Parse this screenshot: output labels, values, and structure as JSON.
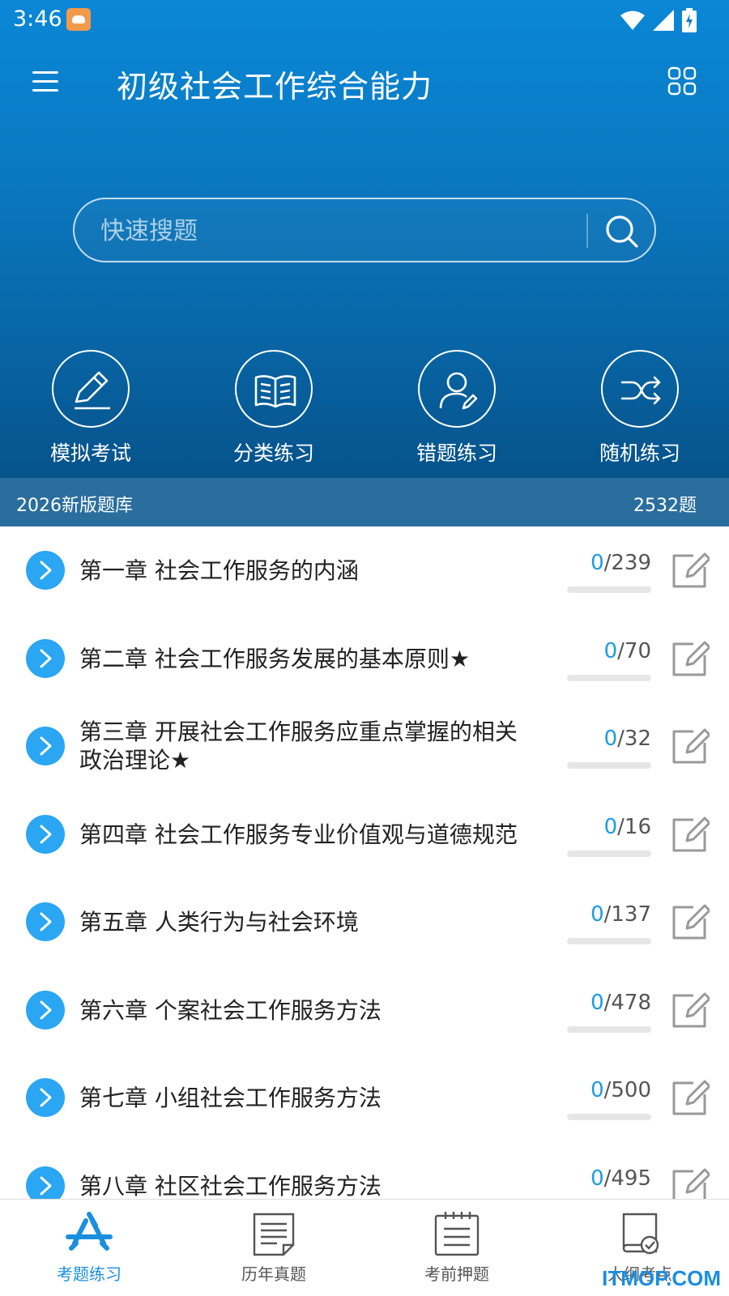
{
  "status": {
    "time": "3:46"
  },
  "header": {
    "title": "初级社会工作综合能力"
  },
  "search": {
    "placeholder": "快速搜题"
  },
  "quick_actions": [
    {
      "label": "模拟考试",
      "icon": "pencil-icon"
    },
    {
      "label": "分类练习",
      "icon": "book-icon"
    },
    {
      "label": "错题练习",
      "icon": "user-edit-icon"
    },
    {
      "label": "随机练习",
      "icon": "shuffle-icon"
    }
  ],
  "bank": {
    "name": "2026新版题库",
    "count": "2532题"
  },
  "chapters": [
    {
      "title": "第一章 社会工作服务的内涵",
      "done": "0",
      "total": "/239",
      "progress": 0
    },
    {
      "title": "第二章 社会工作服务发展的基本原则★",
      "done": "0",
      "total": "/70",
      "progress": 0
    },
    {
      "title": "第三章 开展社会工作服务应重点掌握的相关政治理论★",
      "done": "0",
      "total": "/32",
      "progress": 0
    },
    {
      "title": "第四章 社会工作服务专业价值观与道德规范",
      "done": "0",
      "total": "/16",
      "progress": 0
    },
    {
      "title": "第五章 人类行为与社会环境",
      "done": "0",
      "total": "/137",
      "progress": 0
    },
    {
      "title": "第六章 个案社会工作服务方法",
      "done": "0",
      "total": "/478",
      "progress": 0
    },
    {
      "title": "第七章 小组社会工作服务方法",
      "done": "0",
      "total": "/500",
      "progress": 0
    },
    {
      "title": "第八章 社区社会工作服务方法",
      "done": "0",
      "total": "/495",
      "progress": 0
    }
  ],
  "bottom_nav": [
    {
      "label": "考题练习",
      "active": true
    },
    {
      "label": "历年真题",
      "active": false
    },
    {
      "label": "考前押题",
      "active": false
    },
    {
      "label": "大纲考点",
      "active": false
    }
  ],
  "watermark": "ITMOP.COM",
  "colors": {
    "accent": "#1a9be6",
    "header": "#0a7cc6",
    "bank_bar": "#2a6e9e"
  }
}
